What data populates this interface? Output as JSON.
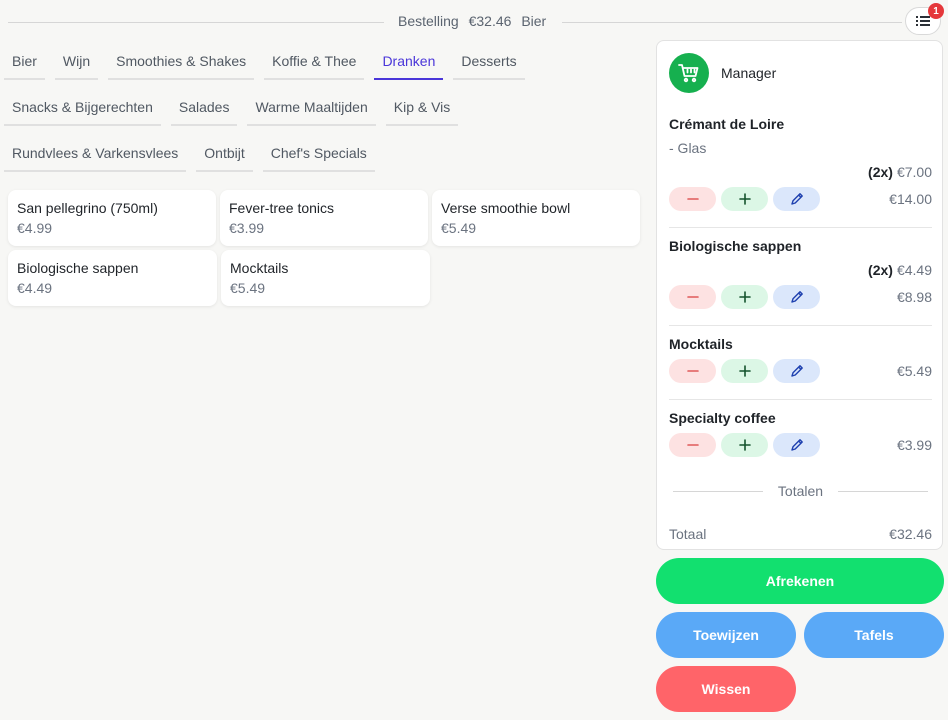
{
  "header": {
    "label": "Bestelling",
    "amount": "€32.46",
    "category": "Bier",
    "badge_count": "1"
  },
  "tabs": {
    "rows": [
      [
        "Bier",
        "Wijn",
        "Smoothies & Shakes",
        "Koffie & Thee",
        "Dranken",
        "Desserts"
      ],
      [
        "Snacks & Bijgerechten",
        "Salades",
        "Warme Maaltijden",
        "Kip & Vis"
      ],
      [
        "Rundvlees & Varkensvlees",
        "Ontbijt",
        "Chef's Specials"
      ]
    ],
    "active": "Dranken"
  },
  "products": [
    {
      "name": "San pellegrino (750ml)",
      "price": "€4.99"
    },
    {
      "name": "Fever-tree tonics",
      "price": "€3.99"
    },
    {
      "name": "Verse smoothie bowl",
      "price": "€5.49"
    },
    {
      "name": "Biologische sappen",
      "price": "€4.49"
    },
    {
      "name": "Mocktails",
      "price": "€5.49"
    }
  ],
  "order": {
    "user": "Manager",
    "items": [
      {
        "name": "Crémant de Loire",
        "modifier": "- Glas",
        "qty": "(2x)",
        "unit_price": "€7.00",
        "total": "€14.00"
      },
      {
        "name": "Biologische sappen",
        "qty": "(2x)",
        "unit_price": "€4.49",
        "total": "€8.98"
      },
      {
        "name": "Mocktails",
        "total": "€5.49"
      },
      {
        "name": "Specialty coffee",
        "total": "€3.99"
      }
    ],
    "totals_heading": "Totalen",
    "total_label": "Totaal",
    "total_value": "€32.46"
  },
  "actions": {
    "checkout": "Afrekenen",
    "assign": "Toewijzen",
    "tables": "Tafels",
    "clear": "Wissen"
  },
  "colors": {
    "accent": "#4a36d9",
    "checkout": "#12e06f",
    "secondary": "#5aa9f7",
    "danger": "#ff6469",
    "cart": "#16b04f"
  }
}
